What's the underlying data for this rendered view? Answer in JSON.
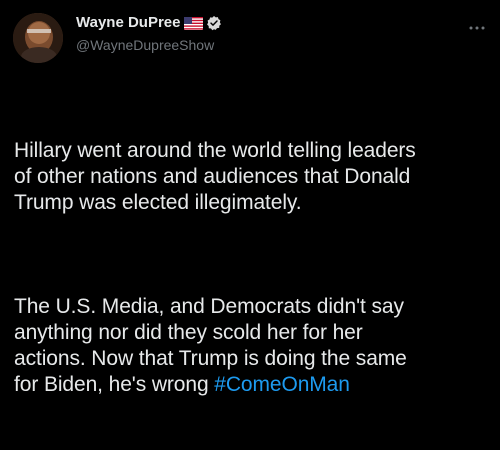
{
  "author": {
    "display_name": "Wayne DuPree",
    "flag_icon": "us-flag-icon",
    "verified_icon": "verified-badge-icon",
    "handle": "@WayneDupreeShow"
  },
  "more_icon": "more-dots-icon",
  "tweet": {
    "paragraph_1": "Hillary went around the world telling leaders\nof other nations and audiences that Donald\nTrump was elected illegimately.",
    "paragraph_2": "The U.S. Media, and Democrats didn't say\nanything nor did they scold her for her\nactions. Now that Trump is doing the same\nfor Biden, he's wrong ",
    "hashtag": "#ComeOnMan"
  },
  "colors": {
    "background": "#000000",
    "text": "#e7e9ea",
    "secondary": "#71767b",
    "accent": "#1d9bf0"
  }
}
